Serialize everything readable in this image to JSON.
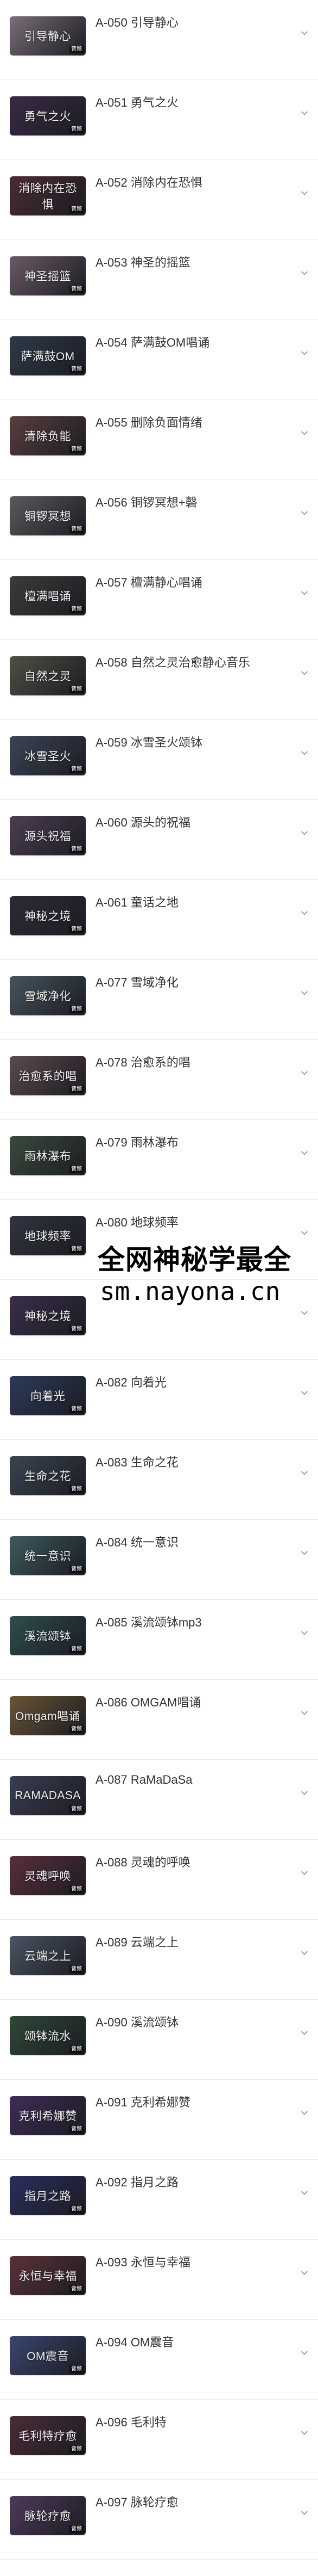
{
  "badge_text": "音频",
  "items": [
    {
      "label": "A-050 引导静心",
      "thumb": "引导静心",
      "bg": "#7a6e78"
    },
    {
      "label": "A-051 勇气之火",
      "thumb": "勇气之火",
      "bg": "#3a2a44"
    },
    {
      "label": "A-052 消除内在恐惧",
      "thumb": "消除内在恐惧",
      "bg": "#4a2c34"
    },
    {
      "label": "A-053 神圣的摇篮",
      "thumb": "神圣摇篮",
      "bg": "#6a5a66"
    },
    {
      "label": "A-054 萨满鼓OM唱诵",
      "thumb": "萨满鼓OM",
      "bg": "#2e3a48"
    },
    {
      "label": "A-055 删除负面情绪",
      "thumb": "清除负能",
      "bg": "#5a3e40"
    },
    {
      "label": "A-056 铜锣冥想+磬",
      "thumb": "铜锣冥想",
      "bg": "#5a5a5e"
    },
    {
      "label": "A-057 檀满静心唱诵",
      "thumb": "檀满唱诵",
      "bg": "#3e3a3a"
    },
    {
      "label": "A-058 自然之灵治愈静心音乐",
      "thumb": "自然之灵",
      "bg": "#4e5044"
    },
    {
      "label": "A-059 冰雪圣火颂钵",
      "thumb": "冰雪圣火",
      "bg": "#3c4456"
    },
    {
      "label": "A-060 源头的祝福",
      "thumb": "源头祝福",
      "bg": "#4c3e52"
    },
    {
      "label": "A-061 童话之地",
      "thumb": "神秘之境",
      "bg": "#2e2a36"
    },
    {
      "label": "A-077 雪域净化",
      "thumb": "雪域净化",
      "bg": "#46545c"
    },
    {
      "label": "A-078 治愈系的唱",
      "thumb": "治愈系的唱",
      "bg": "#5c4a50"
    },
    {
      "label": "A-079 雨林瀑布",
      "thumb": "雨林瀑布",
      "bg": "#3a4a3e"
    },
    {
      "label": "A-080 地球频率",
      "thumb": "地球频率",
      "bg": "#30343e"
    },
    {
      "label": "",
      "thumb": "神秘之境",
      "bg": "#3a2e48"
    },
    {
      "label": "A-082 向着光",
      "thumb": "向着光",
      "bg": "#2c3a5a"
    },
    {
      "label": "A-083 生命之花",
      "thumb": "生命之花",
      "bg": "#3a4450"
    },
    {
      "label": "A-084 统一意识",
      "thumb": "统一意识",
      "bg": "#3e5a5e"
    },
    {
      "label": "A-085 溪流颂钵mp3",
      "thumb": "溪流颂钵",
      "bg": "#2e4e4e"
    },
    {
      "label": "A-086 OMGAM唱诵",
      "thumb": "Omgam唱诵",
      "bg": "#6a5436"
    },
    {
      "label": "A-087 RaMaDaSa",
      "thumb": "RAMADASA",
      "bg": "#3a3e52"
    },
    {
      "label": "A-088 灵魂的呼唤",
      "thumb": "灵魂呼唤",
      "bg": "#5a2e3e"
    },
    {
      "label": "A-089 云端之上",
      "thumb": "云端之上",
      "bg": "#4a5462"
    },
    {
      "label": "A-090 溪流颂钵",
      "thumb": "颂钵流水",
      "bg": "#2e4838"
    },
    {
      "label": "A-091 克利希娜赞",
      "thumb": "克利希娜赞",
      "bg": "#3e2c56"
    },
    {
      "label": "A-092 指月之路",
      "thumb": "指月之路",
      "bg": "#2a2e5e"
    },
    {
      "label": "A-093 永恒与幸福",
      "thumb": "永恒与幸福",
      "bg": "#5a3238"
    },
    {
      "label": "A-094 OM震音",
      "thumb": "OM震音",
      "bg": "#3a4670"
    },
    {
      "label": "A-096 毛利特",
      "thumb": "毛利特疗愈",
      "bg": "#4a2c38"
    },
    {
      "label": "A-097 脉轮疗愈",
      "thumb": "脉轮疗愈",
      "bg": "#4e3a5a"
    }
  ],
  "watermark": {
    "line1": "全网神秘学最全",
    "line2": "sm.nayona.cn"
  }
}
